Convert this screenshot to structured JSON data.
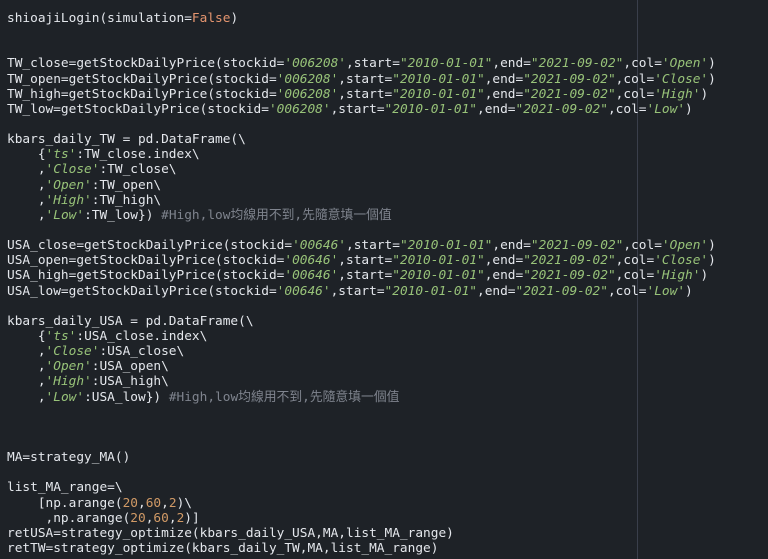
{
  "editor": {
    "colors": {
      "background": "#1e2227",
      "text": "#e4e7ec",
      "string": "#98c379",
      "number": "#d19a66",
      "keyword": "#e5956f",
      "comment": "#7f848e",
      "ruler": "#3a3f4b"
    },
    "lines": [
      [
        {
          "t": "shioajiLogin(simulation=",
          "k": "name"
        },
        {
          "t": "False",
          "k": "kw"
        },
        {
          "t": ")",
          "k": "name"
        }
      ],
      [],
      [],
      [
        {
          "t": "TW_close=getStockDailyPrice(stockid=",
          "k": "name"
        },
        {
          "t": "'006208'",
          "k": "str"
        },
        {
          "t": ",start=",
          "k": "name"
        },
        {
          "t": "\"2010-01-01\"",
          "k": "str"
        },
        {
          "t": ",end=",
          "k": "name"
        },
        {
          "t": "\"2021-09-02\"",
          "k": "str"
        },
        {
          "t": ",col=",
          "k": "name"
        },
        {
          "t": "'Open'",
          "k": "str"
        },
        {
          "t": ")",
          "k": "name"
        }
      ],
      [
        {
          "t": "TW_open=getStockDailyPrice(stockid=",
          "k": "name"
        },
        {
          "t": "'006208'",
          "k": "str"
        },
        {
          "t": ",start=",
          "k": "name"
        },
        {
          "t": "\"2010-01-01\"",
          "k": "str"
        },
        {
          "t": ",end=",
          "k": "name"
        },
        {
          "t": "\"2021-09-02\"",
          "k": "str"
        },
        {
          "t": ",col=",
          "k": "name"
        },
        {
          "t": "'Close'",
          "k": "str"
        },
        {
          "t": ")",
          "k": "name"
        }
      ],
      [
        {
          "t": "TW_high=getStockDailyPrice(stockid=",
          "k": "name"
        },
        {
          "t": "'006208'",
          "k": "str"
        },
        {
          "t": ",start=",
          "k": "name"
        },
        {
          "t": "\"2010-01-01\"",
          "k": "str"
        },
        {
          "t": ",end=",
          "k": "name"
        },
        {
          "t": "\"2021-09-02\"",
          "k": "str"
        },
        {
          "t": ",col=",
          "k": "name"
        },
        {
          "t": "'High'",
          "k": "str"
        },
        {
          "t": ")",
          "k": "name"
        }
      ],
      [
        {
          "t": "TW_low=getStockDailyPrice(stockid=",
          "k": "name"
        },
        {
          "t": "'006208'",
          "k": "str"
        },
        {
          "t": ",start=",
          "k": "name"
        },
        {
          "t": "\"2010-01-01\"",
          "k": "str"
        },
        {
          "t": ",end=",
          "k": "name"
        },
        {
          "t": "\"2021-09-02\"",
          "k": "str"
        },
        {
          "t": ",col=",
          "k": "name"
        },
        {
          "t": "'Low'",
          "k": "str"
        },
        {
          "t": ")",
          "k": "name"
        }
      ],
      [],
      [
        {
          "t": "kbars_daily_TW = pd.DataFrame(\\",
          "k": "name"
        }
      ],
      [
        {
          "t": "    {",
          "k": "name"
        },
        {
          "t": "'ts'",
          "k": "str"
        },
        {
          "t": ":TW_close.index\\",
          "k": "name"
        }
      ],
      [
        {
          "t": "    ,",
          "k": "name"
        },
        {
          "t": "'Close'",
          "k": "str"
        },
        {
          "t": ":TW_close\\",
          "k": "name"
        }
      ],
      [
        {
          "t": "    ,",
          "k": "name"
        },
        {
          "t": "'Open'",
          "k": "str"
        },
        {
          "t": ":TW_open\\",
          "k": "name"
        }
      ],
      [
        {
          "t": "    ,",
          "k": "name"
        },
        {
          "t": "'High'",
          "k": "str"
        },
        {
          "t": ":TW_high\\",
          "k": "name"
        }
      ],
      [
        {
          "t": "    ,",
          "k": "name"
        },
        {
          "t": "'Low'",
          "k": "str"
        },
        {
          "t": ":TW_low}) ",
          "k": "name"
        },
        {
          "t": "#High,low均線用不到,先隨意填一個值",
          "k": "comment"
        }
      ],
      [],
      [
        {
          "t": "USA_close=getStockDailyPrice(stockid=",
          "k": "name"
        },
        {
          "t": "'00646'",
          "k": "str"
        },
        {
          "t": ",start=",
          "k": "name"
        },
        {
          "t": "\"2010-01-01\"",
          "k": "str"
        },
        {
          "t": ",end=",
          "k": "name"
        },
        {
          "t": "\"2021-09-02\"",
          "k": "str"
        },
        {
          "t": ",col=",
          "k": "name"
        },
        {
          "t": "'Open'",
          "k": "str"
        },
        {
          "t": ")",
          "k": "name"
        }
      ],
      [
        {
          "t": "USA_open=getStockDailyPrice(stockid=",
          "k": "name"
        },
        {
          "t": "'00646'",
          "k": "str"
        },
        {
          "t": ",start=",
          "k": "name"
        },
        {
          "t": "\"2010-01-01\"",
          "k": "str"
        },
        {
          "t": ",end=",
          "k": "name"
        },
        {
          "t": "\"2021-09-02\"",
          "k": "str"
        },
        {
          "t": ",col=",
          "k": "name"
        },
        {
          "t": "'Close'",
          "k": "str"
        },
        {
          "t": ")",
          "k": "name"
        }
      ],
      [
        {
          "t": "USA_high=getStockDailyPrice(stockid=",
          "k": "name"
        },
        {
          "t": "'00646'",
          "k": "str"
        },
        {
          "t": ",start=",
          "k": "name"
        },
        {
          "t": "\"2010-01-01\"",
          "k": "str"
        },
        {
          "t": ",end=",
          "k": "name"
        },
        {
          "t": "\"2021-09-02\"",
          "k": "str"
        },
        {
          "t": ",col=",
          "k": "name"
        },
        {
          "t": "'High'",
          "k": "str"
        },
        {
          "t": ")",
          "k": "name"
        }
      ],
      [
        {
          "t": "USA_low=getStockDailyPrice(stockid=",
          "k": "name"
        },
        {
          "t": "'00646'",
          "k": "str"
        },
        {
          "t": ",start=",
          "k": "name"
        },
        {
          "t": "\"2010-01-01\"",
          "k": "str"
        },
        {
          "t": ",end=",
          "k": "name"
        },
        {
          "t": "\"2021-09-02\"",
          "k": "str"
        },
        {
          "t": ",col=",
          "k": "name"
        },
        {
          "t": "'Low'",
          "k": "str"
        },
        {
          "t": ")",
          "k": "name"
        }
      ],
      [],
      [
        {
          "t": "kbars_daily_USA = pd.DataFrame(\\",
          "k": "name"
        }
      ],
      [
        {
          "t": "    {",
          "k": "name"
        },
        {
          "t": "'ts'",
          "k": "str"
        },
        {
          "t": ":USA_close.index\\",
          "k": "name"
        }
      ],
      [
        {
          "t": "    ,",
          "k": "name"
        },
        {
          "t": "'Close'",
          "k": "str"
        },
        {
          "t": ":USA_close\\",
          "k": "name"
        }
      ],
      [
        {
          "t": "    ,",
          "k": "name"
        },
        {
          "t": "'Open'",
          "k": "str"
        },
        {
          "t": ":USA_open\\",
          "k": "name"
        }
      ],
      [
        {
          "t": "    ,",
          "k": "name"
        },
        {
          "t": "'High'",
          "k": "str"
        },
        {
          "t": ":USA_high\\",
          "k": "name"
        }
      ],
      [
        {
          "t": "    ,",
          "k": "name"
        },
        {
          "t": "'Low'",
          "k": "str"
        },
        {
          "t": ":USA_low}) ",
          "k": "name"
        },
        {
          "t": "#High,low均線用不到,先隨意填一個值",
          "k": "comment"
        }
      ],
      [],
      [],
      [],
      [
        {
          "t": "MA=strategy_MA()",
          "k": "name"
        }
      ],
      [],
      [
        {
          "t": "list_MA_range=\\",
          "k": "name"
        }
      ],
      [
        {
          "t": "    [np.arange(",
          "k": "name"
        },
        {
          "t": "20",
          "k": "num"
        },
        {
          "t": ",",
          "k": "name"
        },
        {
          "t": "60",
          "k": "num"
        },
        {
          "t": ",",
          "k": "name"
        },
        {
          "t": "2",
          "k": "num"
        },
        {
          "t": ")\\",
          "k": "name"
        }
      ],
      [
        {
          "t": "     ,np.arange(",
          "k": "name"
        },
        {
          "t": "20",
          "k": "num"
        },
        {
          "t": ",",
          "k": "name"
        },
        {
          "t": "60",
          "k": "num"
        },
        {
          "t": ",",
          "k": "name"
        },
        {
          "t": "2",
          "k": "num"
        },
        {
          "t": ")]",
          "k": "name"
        }
      ],
      [
        {
          "t": "retUSA=strategy_optimize(kbars_daily_USA,MA,list_MA_range)",
          "k": "name"
        }
      ],
      [
        {
          "t": "retTW=strategy_optimize(kbars_daily_TW,MA,list_MA_range)",
          "k": "name"
        }
      ]
    ]
  }
}
